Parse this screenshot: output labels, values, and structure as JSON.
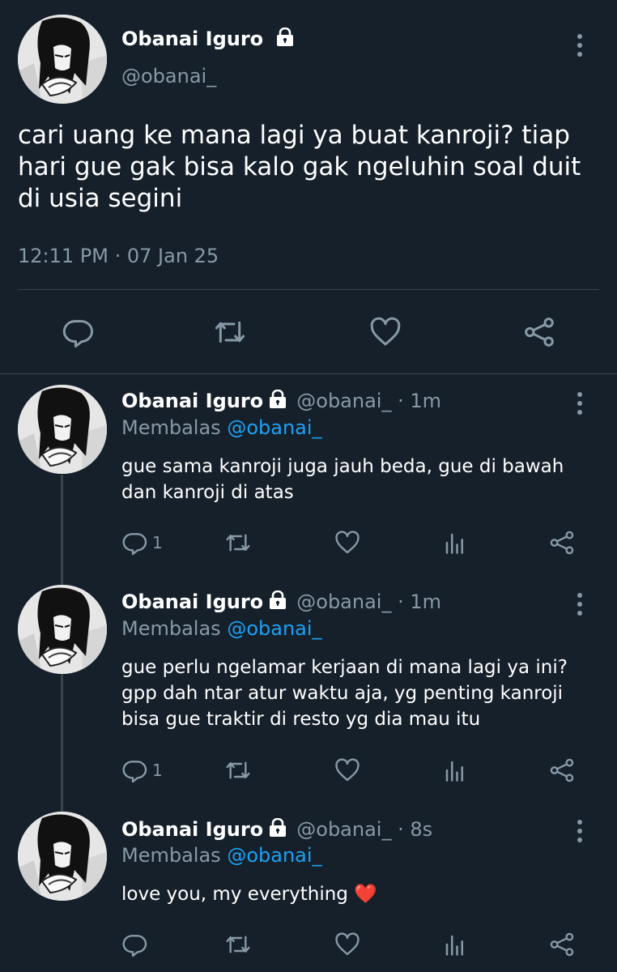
{
  "main_tweet": {
    "display_name": "Obanai Iguro",
    "handle": "@obanai_",
    "text_lines": [
      "cari uang ke mana lagi ya buat kanroji? tiap",
      "hari gue gak bisa kalo gak ngeluhin soal duit",
      "di usia segini"
    ],
    "timestamp": "12:11 PM · 07 Jan 25",
    "icons": [
      "reply-icon",
      "retweet-icon",
      "like-icon",
      "share-icon"
    ]
  },
  "replies": [
    {
      "display_name": "Obanai Iguro",
      "meta": "@obanai_ · 1m",
      "replying_prefix": "Membalas",
      "replying_to": "@obanai_",
      "text_lines": [
        "gue sama kanroji juga jauh beda, gue di bawah",
        "dan kanroji di atas"
      ],
      "reply_count": "1"
    },
    {
      "display_name": "Obanai Iguro",
      "meta": "@obanai_ · 1m",
      "replying_prefix": "Membalas",
      "replying_to": "@obanai_",
      "text_lines": [
        "gue perlu ngelamar kerjaan di mana lagi ya ini?",
        "gpp dah ntar atur waktu aja, yg penting kanroji",
        "bisa gue traktir di resto yg dia mau itu"
      ],
      "reply_count": "1"
    },
    {
      "display_name": "Obanai Iguro",
      "meta": "@obanai_ · 8s",
      "replying_prefix": "Membalas",
      "replying_to": "@obanai_",
      "text_lines": [
        "love you, my everything ❤️"
      ],
      "reply_count": ""
    }
  ],
  "colors": {
    "background": "#15202b",
    "secondary_text": "#8899a6",
    "mention": "#1da1f2",
    "divider": "#38444d"
  }
}
